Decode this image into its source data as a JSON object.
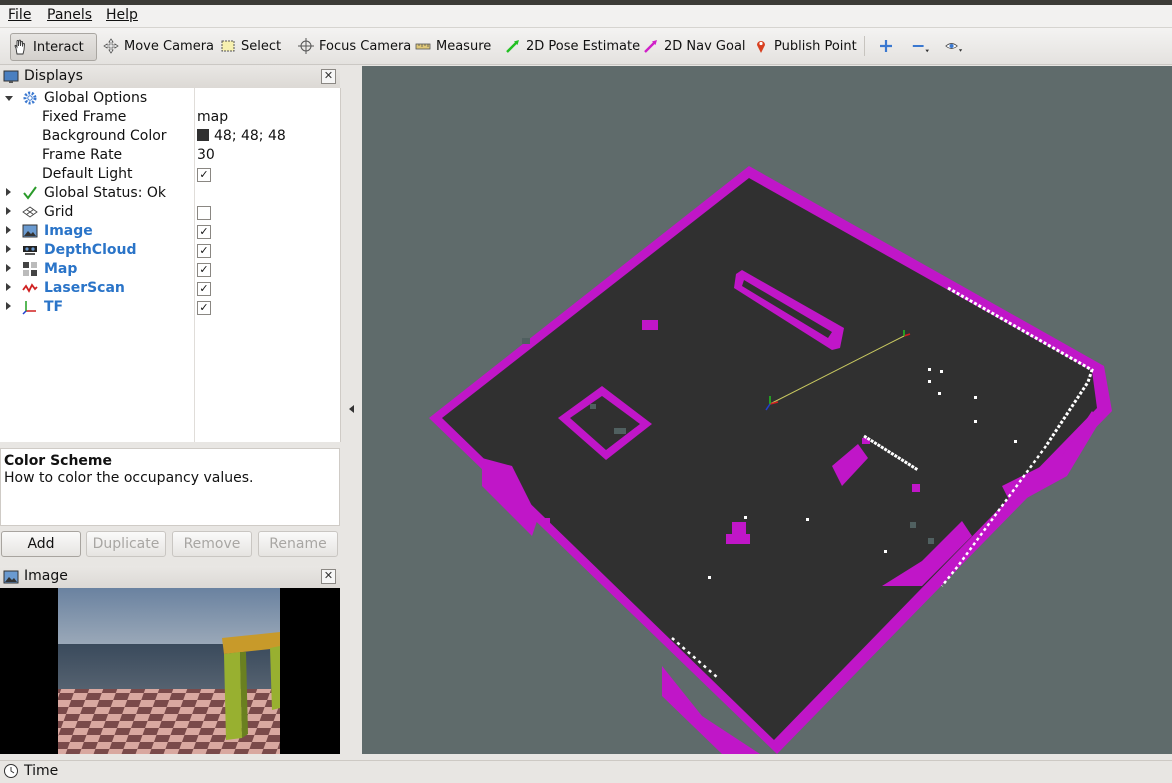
{
  "menu": {
    "file": {
      "label": "File"
    },
    "panels": {
      "label": "Panels"
    },
    "help": {
      "label": "Help"
    }
  },
  "toolbar": {
    "interact": "Interact",
    "move_camera": "Move Camera",
    "select": "Select",
    "focus_camera": "Focus Camera",
    "measure": "Measure",
    "pose_estimate": "2D Pose Estimate",
    "nav_goal": "2D Nav Goal",
    "publish_point": "Publish Point"
  },
  "displays_panel": {
    "title": "Displays",
    "global_options": {
      "label": "Global Options",
      "fixed_frame": {
        "label": "Fixed Frame",
        "value": "map"
      },
      "background_color": {
        "label": "Background Color",
        "value": "48; 48; 48",
        "color": "#303030"
      },
      "frame_rate": {
        "label": "Frame Rate",
        "value": "30"
      },
      "default_light": {
        "label": "Default Light",
        "checked": true
      }
    },
    "global_status": {
      "label": "Global Status: Ok"
    },
    "items": [
      {
        "label": "Grid",
        "checked": false,
        "icon": "grid-icon"
      },
      {
        "label": "Image",
        "checked": true,
        "icon": "image-icon"
      },
      {
        "label": "DepthCloud",
        "checked": true,
        "icon": "depthcloud-icon"
      },
      {
        "label": "Map",
        "checked": true,
        "icon": "map-icon"
      },
      {
        "label": "LaserScan",
        "checked": true,
        "icon": "laserscan-icon"
      },
      {
        "label": "TF",
        "checked": true,
        "icon": "tf-icon"
      }
    ]
  },
  "description": {
    "title": "Color Scheme",
    "text": "How to color the occupancy values."
  },
  "buttons": {
    "add": "Add",
    "duplicate": "Duplicate",
    "remove": "Remove",
    "rename": "Rename"
  },
  "image_panel": {
    "title": "Image"
  },
  "status_bar": {
    "time_label": "Time"
  },
  "colors": {
    "viewport_bg": "#5f6b6b",
    "map_free": "#303030",
    "map_obstacle": "#c016c8",
    "laser": "#ffffff",
    "link_blue": "#2a74c8"
  }
}
